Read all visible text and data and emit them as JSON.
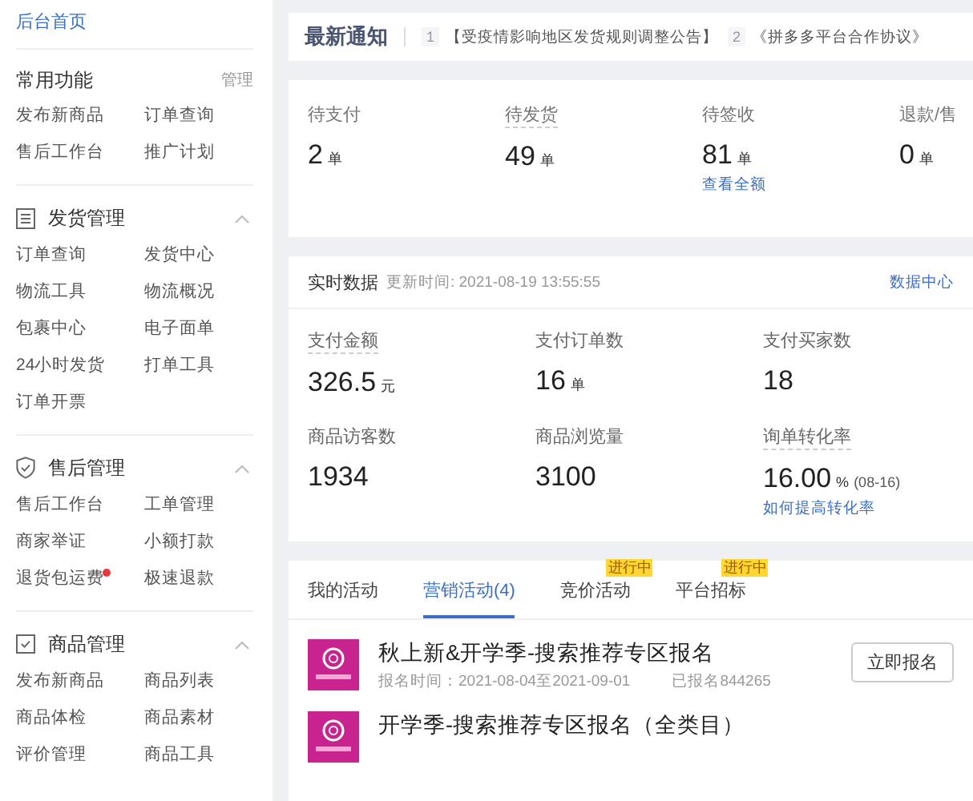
{
  "sidebar": {
    "home_link": "后台首页",
    "favorites": {
      "title": "常用功能",
      "manage": "管理",
      "items": [
        {
          "label": "发布新商品",
          "dot": false
        },
        {
          "label": "订单查询",
          "dot": false
        },
        {
          "label": "售后工作台",
          "dot": false
        },
        {
          "label": "推广计划",
          "dot": false
        }
      ]
    },
    "sections": [
      {
        "kind": "list",
        "title": "发货管理",
        "expanded": true,
        "items": [
          {
            "label": "订单查询",
            "dot": false
          },
          {
            "label": "发货中心",
            "dot": false
          },
          {
            "label": "物流工具",
            "dot": false
          },
          {
            "label": "物流概况",
            "dot": false
          },
          {
            "label": "包裹中心",
            "dot": false
          },
          {
            "label": "电子面单",
            "dot": false
          },
          {
            "label": "24小时发货",
            "dot": false
          },
          {
            "label": "打单工具",
            "dot": false
          },
          {
            "label": "订单开票",
            "dot": false
          }
        ]
      },
      {
        "kind": "shield",
        "title": "售后管理",
        "expanded": true,
        "items": [
          {
            "label": "售后工作台",
            "dot": false
          },
          {
            "label": "工单管理",
            "dot": false
          },
          {
            "label": "商家举证",
            "dot": false
          },
          {
            "label": "小额打款",
            "dot": false
          },
          {
            "label": "退货包运费",
            "dot": true
          },
          {
            "label": "极速退款",
            "dot": false
          }
        ]
      },
      {
        "kind": "box",
        "title": "商品管理",
        "expanded": true,
        "items": [
          {
            "label": "发布新商品",
            "dot": false
          },
          {
            "label": "商品列表",
            "dot": false
          },
          {
            "label": "商品体检",
            "dot": false
          },
          {
            "label": "商品素材",
            "dot": false
          },
          {
            "label": "评价管理",
            "dot": false
          },
          {
            "label": "商品工具",
            "dot": false
          }
        ]
      }
    ]
  },
  "notice": {
    "title": "最新通知",
    "items": [
      {
        "index": "1",
        "text": "【受疫情影响地区发货规则调整公告】"
      },
      {
        "index": "2",
        "text": "《拼多多平台合作协议》"
      }
    ]
  },
  "orders": [
    {
      "label": "待支付",
      "value": "2",
      "unit": "单"
    },
    {
      "label": "待发货",
      "value": "49",
      "unit": "单"
    },
    {
      "label": "待签收",
      "value": "81",
      "unit": "单",
      "link": "查看全额"
    },
    {
      "label": "退款/售",
      "value": "0",
      "unit": "单"
    }
  ],
  "realtime": {
    "title": "实时数据",
    "updated": "更新时间: 2021-08-19 13:55:55",
    "link": "数据中心",
    "metrics": [
      {
        "label": "支付金额",
        "value": "326.5",
        "unit": "元"
      },
      {
        "label": "支付订单数",
        "value": "16",
        "unit": "单"
      },
      {
        "label": "支付买家数",
        "value": "18"
      },
      {
        "label": "商品访客数",
        "value": "1934"
      },
      {
        "label": "商品浏览量",
        "value": "3100"
      },
      {
        "label": "询单转化率",
        "value": "16.00",
        "unit": "%",
        "note": "(08-16)",
        "link": "如何提高转化率"
      }
    ]
  },
  "activities": {
    "tabs": [
      {
        "label": "我的活动",
        "selected": false
      },
      {
        "label": "营销活动(4)",
        "selected": true
      },
      {
        "label": "竞价活动",
        "selected": false,
        "badge": "进行中"
      },
      {
        "label": "平台招标",
        "selected": false,
        "badge": "进行中"
      }
    ],
    "items": [
      {
        "title": "秋上新&开学季-搜索推荐专区报名",
        "period": "报名时间：2021-08-04至2021-09-01",
        "count": "已报名844265",
        "button": "立即报名"
      },
      {
        "title": "开学季-搜索推荐专区报名（全类目）"
      }
    ]
  }
}
